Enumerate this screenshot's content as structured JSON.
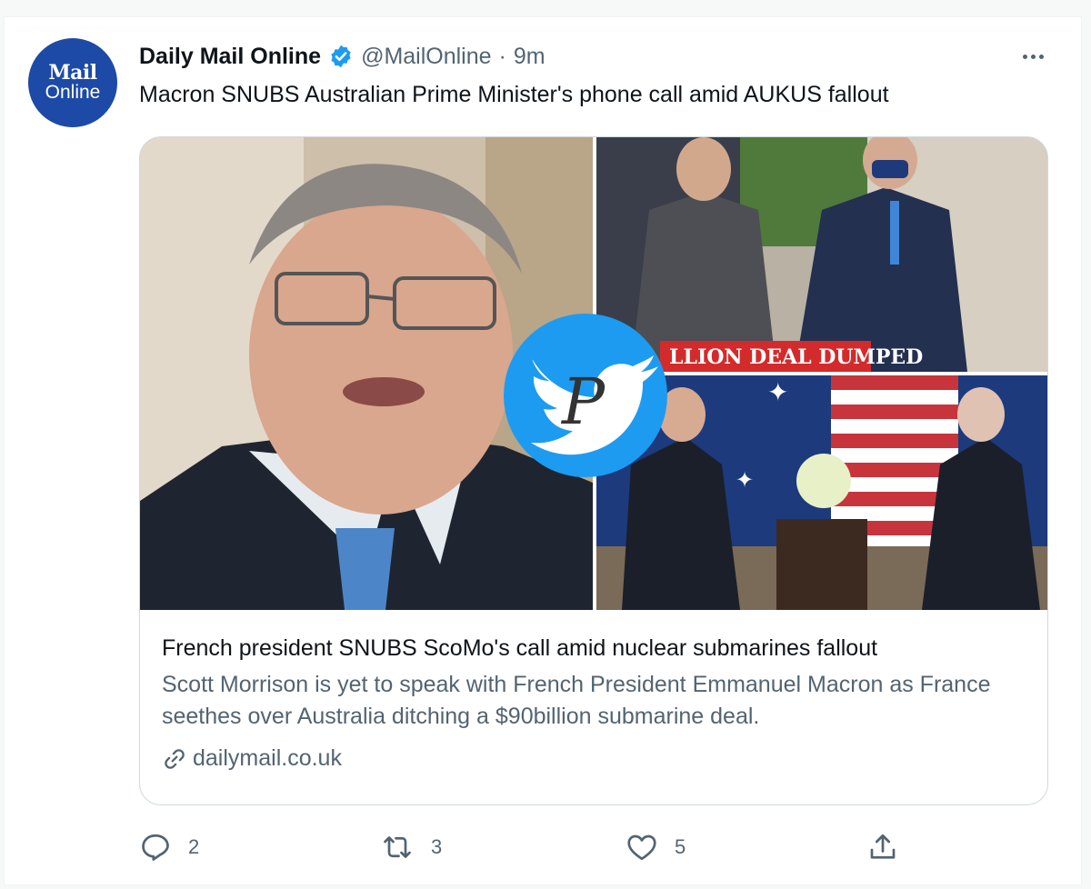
{
  "account": {
    "name": "Daily Mail Online",
    "handle": "@MailOnline",
    "separator": "·",
    "time": "9m",
    "avatar_logo_top": "Mail",
    "avatar_logo_bottom": "Online"
  },
  "tweet": {
    "text": "Macron SNUBS Australian Prime Minister's phone call amid AUKUS fallout"
  },
  "card": {
    "banner": "LLION DEAL DUMPED",
    "watermark_letter": "P",
    "title": "French president SNUBS ScoMo's call amid nuclear submarines fallout",
    "description": "Scott Morrison is yet to speak with French President Emmanuel Macron as France seethes over Australia ditching a $90billion submarine deal.",
    "domain": "dailymail.co.uk"
  },
  "actions": {
    "replies": "2",
    "retweets": "3",
    "likes": "5"
  },
  "icons": [
    "verified-badge-icon",
    "more-options-icon",
    "link-icon",
    "reply-icon",
    "retweet-icon",
    "like-icon",
    "share-icon",
    "twitter-bird-watermark-icon"
  ],
  "colors": {
    "verified_blue": "#1d9bf0",
    "text_primary": "#0f1419",
    "text_secondary": "#536471",
    "mail_blue": "#1c4aa6",
    "banner_red": "#d32b2b",
    "watermark_blue": "#1d9bf0"
  }
}
